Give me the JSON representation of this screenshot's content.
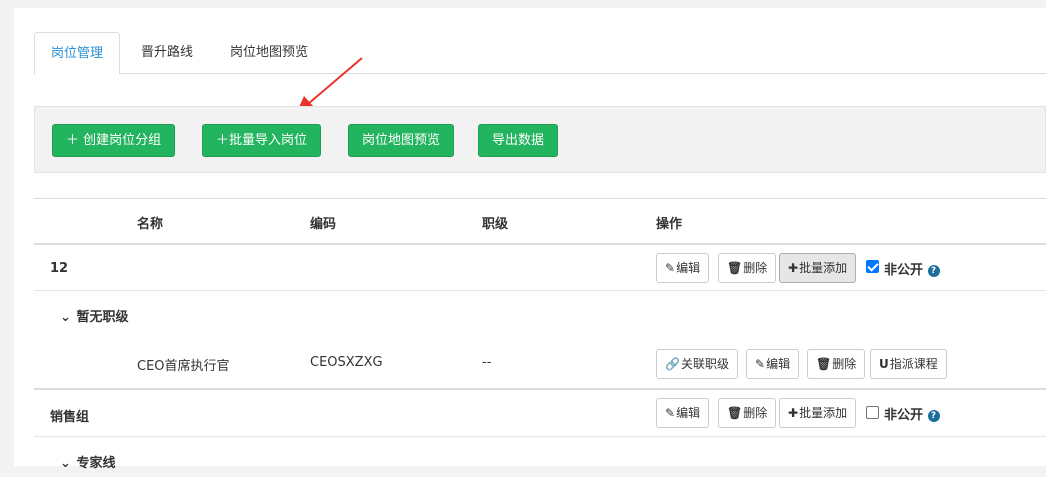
{
  "tabs": [
    "岗位管理",
    "晋升路线",
    "岗位地图预览"
  ],
  "toolbar": {
    "create_group": "＋ 创建岗位分组",
    "batch_import": "＋批量导入岗位",
    "map_preview": "岗位地图预览",
    "export": "导出数据"
  },
  "table": {
    "headers": {
      "name": "名称",
      "code": "编码",
      "level": "职级",
      "ops": "操作"
    },
    "groups": [
      {
        "name": "12",
        "edit": "编辑",
        "delete": "删除",
        "batch_add": "批量添加",
        "private_label": "非公开",
        "private_checked": true
      },
      {
        "name": "销售组",
        "edit": "编辑",
        "delete": "删除",
        "batch_add": "批量添加",
        "private_label": "非公开",
        "private_checked": false
      }
    ],
    "subgroups": [
      "暂无职级",
      "专家线"
    ],
    "position": {
      "name": "CEO首席执行官",
      "code": "CEOSXZXG",
      "level": "--",
      "link_level": "关联职级",
      "edit": "编辑",
      "delete": "删除",
      "assign_course": "指派课程"
    }
  },
  "icons": {
    "edit": "edit-icon",
    "delete": "trash-icon",
    "add": "plus-icon",
    "link": "link-icon",
    "course": "magnet-icon",
    "help": "question-circle-icon",
    "chevron": "chevron-down-icon"
  },
  "colors": {
    "primary_green": "#22b45e",
    "active_tab": "#2a8fd6",
    "annotation_arrow": "#e8352b"
  }
}
